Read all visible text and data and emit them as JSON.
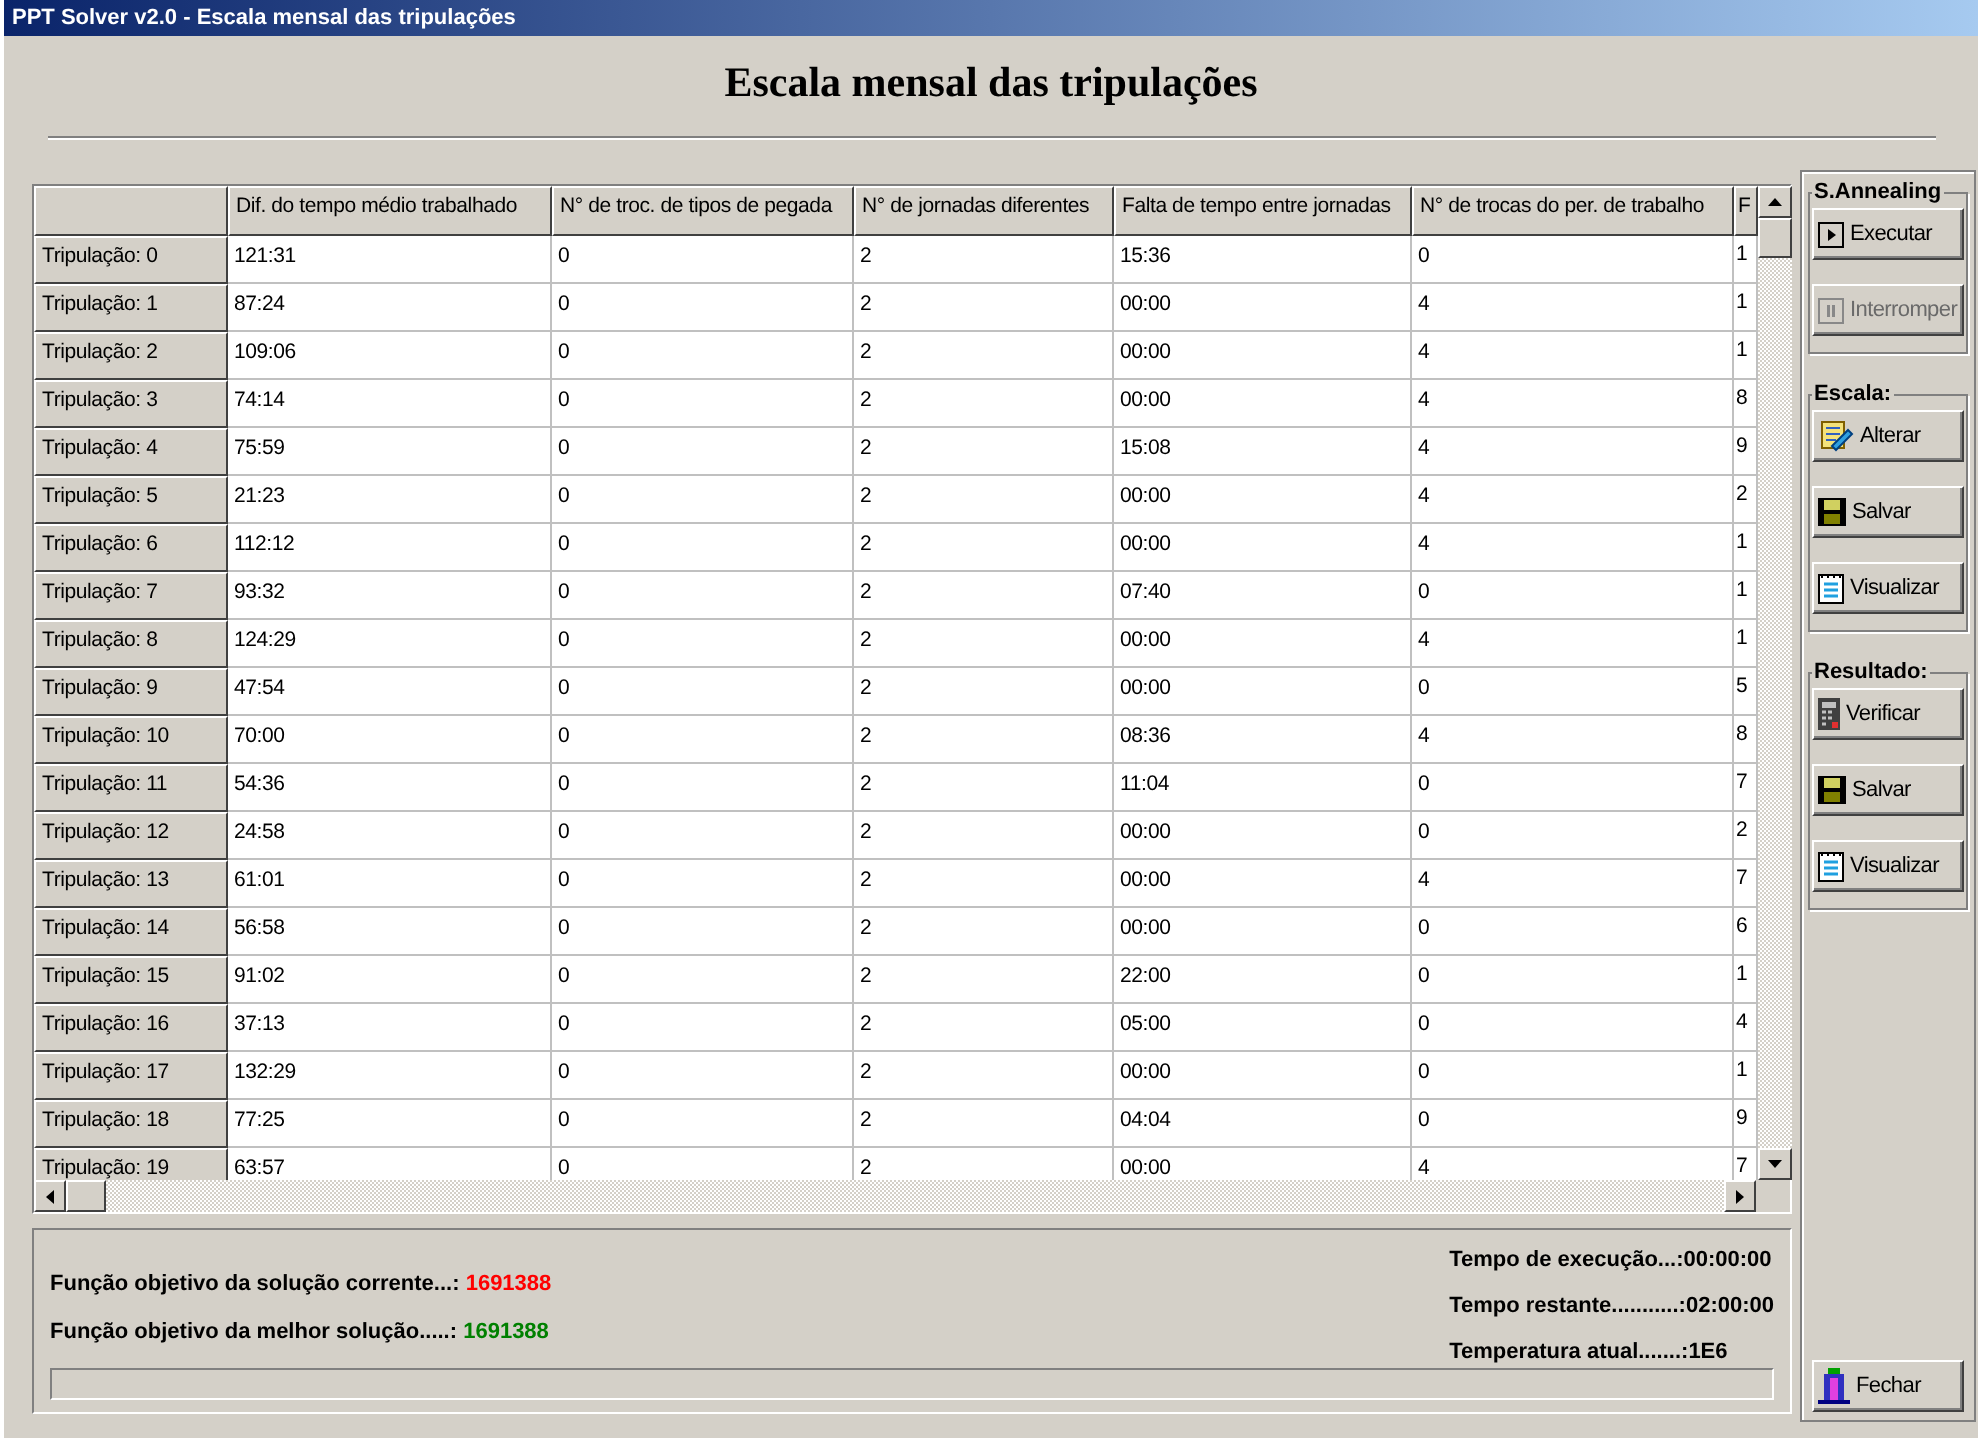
{
  "window": {
    "title": "PPT Solver v2.0 - Escala mensal das tripulações"
  },
  "heading": "Escala mensal das tripulações",
  "table": {
    "columns": [
      "Dif. do tempo médio trabalhado",
      "N° de troc. de tipos de pegada",
      "N° de jornadas diferentes",
      "Falta de tempo entre jornadas",
      "N° de trocas do per. de trabalho",
      "F"
    ],
    "rows": [
      {
        "label": "Tripulação: 0",
        "cells": [
          "121:31",
          "0",
          "2",
          "15:36",
          "0",
          "1"
        ]
      },
      {
        "label": "Tripulação: 1",
        "cells": [
          "87:24",
          "0",
          "2",
          "00:00",
          "4",
          "1"
        ]
      },
      {
        "label": "Tripulação: 2",
        "cells": [
          "109:06",
          "0",
          "2",
          "00:00",
          "4",
          "1"
        ]
      },
      {
        "label": "Tripulação: 3",
        "cells": [
          "74:14",
          "0",
          "2",
          "00:00",
          "4",
          "8"
        ]
      },
      {
        "label": "Tripulação: 4",
        "cells": [
          "75:59",
          "0",
          "2",
          "15:08",
          "4",
          "9"
        ]
      },
      {
        "label": "Tripulação: 5",
        "cells": [
          "21:23",
          "0",
          "2",
          "00:00",
          "4",
          "2"
        ]
      },
      {
        "label": "Tripulação: 6",
        "cells": [
          "112:12",
          "0",
          "2",
          "00:00",
          "4",
          "1"
        ]
      },
      {
        "label": "Tripulação: 7",
        "cells": [
          "93:32",
          "0",
          "2",
          "07:40",
          "0",
          "1"
        ]
      },
      {
        "label": "Tripulação: 8",
        "cells": [
          "124:29",
          "0",
          "2",
          "00:00",
          "4",
          "1"
        ]
      },
      {
        "label": "Tripulação: 9",
        "cells": [
          "47:54",
          "0",
          "2",
          "00:00",
          "0",
          "5"
        ]
      },
      {
        "label": "Tripulação: 10",
        "cells": [
          "70:00",
          "0",
          "2",
          "08:36",
          "4",
          "8"
        ]
      },
      {
        "label": "Tripulação: 11",
        "cells": [
          "54:36",
          "0",
          "2",
          "11:04",
          "0",
          "7"
        ]
      },
      {
        "label": "Tripulação: 12",
        "cells": [
          "24:58",
          "0",
          "2",
          "00:00",
          "0",
          "2"
        ]
      },
      {
        "label": "Tripulação: 13",
        "cells": [
          "61:01",
          "0",
          "2",
          "00:00",
          "4",
          "7"
        ]
      },
      {
        "label": "Tripulação: 14",
        "cells": [
          "56:58",
          "0",
          "2",
          "00:00",
          "0",
          "6"
        ]
      },
      {
        "label": "Tripulação: 15",
        "cells": [
          "91:02",
          "0",
          "2",
          "22:00",
          "0",
          "1"
        ]
      },
      {
        "label": "Tripulação: 16",
        "cells": [
          "37:13",
          "0",
          "2",
          "05:00",
          "0",
          "4"
        ]
      },
      {
        "label": "Tripulação: 17",
        "cells": [
          "132:29",
          "0",
          "2",
          "00:00",
          "0",
          "1"
        ]
      },
      {
        "label": "Tripulação: 18",
        "cells": [
          "77:25",
          "0",
          "2",
          "04:04",
          "0",
          "9"
        ]
      },
      {
        "label": "Tripulação: 19",
        "cells": [
          "63:57",
          "0",
          "2",
          "00:00",
          "4",
          "7"
        ]
      }
    ]
  },
  "status": {
    "left": [
      {
        "label": "Função objetivo da solução corrente...:",
        "value": "1691388",
        "color": "#ff0000"
      },
      {
        "label": "Função objetivo da melhor solução.....:",
        "value": "1691388",
        "color": "#008000"
      }
    ],
    "right": [
      {
        "label": "Tempo de execução...:",
        "value": "00:00:00"
      },
      {
        "label": "Tempo restante...........:",
        "value": "02:00:00"
      },
      {
        "label": "Temperatura atual.......:",
        "value": "1E6"
      }
    ]
  },
  "groups": [
    {
      "title": "S.Annealing",
      "buttons": [
        {
          "label": "Executar",
          "kind": "play",
          "disabled": false
        },
        {
          "label": "Interromper",
          "kind": "pause",
          "disabled": true
        }
      ]
    },
    {
      "title": "Escala:",
      "buttons": [
        {
          "label": "Alterar",
          "kind": "edit",
          "disabled": false
        },
        {
          "label": "Salvar",
          "kind": "save",
          "disabled": false
        },
        {
          "label": "Visualizar",
          "kind": "view",
          "disabled": false
        }
      ]
    },
    {
      "title": "Resultado:",
      "buttons": [
        {
          "label": "Verificar",
          "kind": "check",
          "disabled": false
        },
        {
          "label": "Salvar",
          "kind": "save",
          "disabled": false
        },
        {
          "label": "Visualizar",
          "kind": "view",
          "disabled": false
        }
      ]
    }
  ],
  "close_button": {
    "label": "Fechar"
  }
}
